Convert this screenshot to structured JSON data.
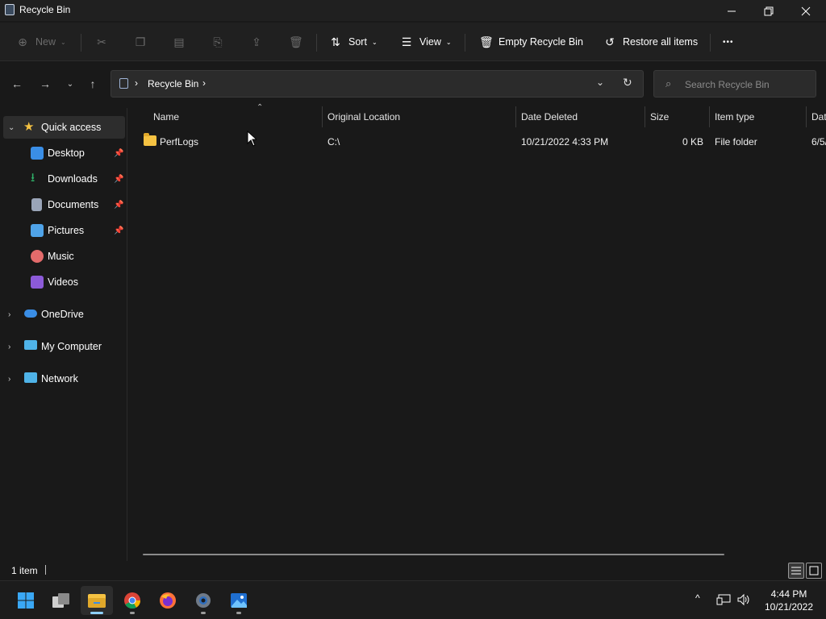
{
  "window": {
    "title": "Recycle Bin"
  },
  "commandbar": {
    "new_label": "New",
    "sort_label": "Sort",
    "view_label": "View",
    "empty_label": "Empty Recycle Bin",
    "restore_label": "Restore all items",
    "more_label": "•••"
  },
  "address": {
    "crumb": "Recycle Bin"
  },
  "search": {
    "placeholder": "Search Recycle Bin"
  },
  "sidebar": {
    "items": [
      {
        "label": "Quick access",
        "icon": "star-icon",
        "color": "#f5c242"
      },
      {
        "label": "Desktop",
        "icon": "desktop-icon",
        "color": "#3a8ee6",
        "pinned": true
      },
      {
        "label": "Downloads",
        "icon": "download-icon",
        "color": "#2fb36a",
        "pinned": true
      },
      {
        "label": "Documents",
        "icon": "document-icon",
        "color": "#9aa5b8",
        "pinned": true
      },
      {
        "label": "Pictures",
        "icon": "pictures-icon",
        "color": "#4fa3e8",
        "pinned": true
      },
      {
        "label": "Music",
        "icon": "music-icon",
        "color": "#e36b6b"
      },
      {
        "label": "Videos",
        "icon": "videos-icon",
        "color": "#8c5ad8"
      },
      {
        "label": "OneDrive",
        "icon": "cloud-icon",
        "color": "#3a8ee6"
      },
      {
        "label": "My Computer",
        "icon": "computer-icon",
        "color": "#4fb3e8"
      },
      {
        "label": "Network",
        "icon": "network-icon",
        "color": "#4fb3e8"
      }
    ]
  },
  "table": {
    "columns": [
      "Name",
      "Original Location",
      "Date Deleted",
      "Size",
      "Item type",
      "Dat"
    ],
    "rows": [
      {
        "name": "PerfLogs",
        "location": "C:\\",
        "date_deleted": "10/21/2022 4:33 PM",
        "size": "0 KB",
        "type": "File folder",
        "extra": "6/5/"
      }
    ]
  },
  "status": {
    "count": "1 item"
  },
  "taskbar": {
    "apps": [
      "start-icon",
      "task-view-icon",
      "file-explorer-icon",
      "chrome-icon",
      "firefox-icon",
      "settings-icon",
      "photos-icon"
    ],
    "time": "4:44 PM",
    "date": "10/21/2022"
  }
}
